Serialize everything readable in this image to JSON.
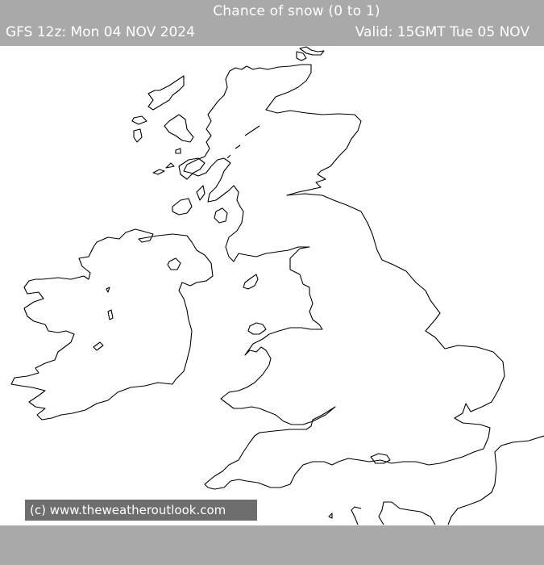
{
  "header": {
    "title": "Chance of snow (0 to 1)",
    "model_run": "GFS 12z: Mon 04 NOV 2024",
    "valid_time": "Valid: 15GMT Tue 05 NOV"
  },
  "map": {
    "region": "British Isles",
    "parameter": "Chance of snow",
    "scale_range": [
      0,
      1
    ],
    "coastline_color": "#000000",
    "background_color": "#ffffff"
  },
  "copyright": {
    "text": "(c)  www.theweatheroutlook.com"
  },
  "colors": {
    "bar_gray": "#a9a9a9",
    "badge_gray": "#6e6e6e",
    "text_white": "#ffffff"
  }
}
